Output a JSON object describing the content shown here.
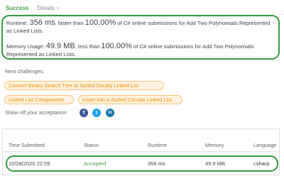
{
  "tabs": {
    "success": "Success",
    "details": "Details"
  },
  "result": {
    "runtime_label": "Runtime: ",
    "runtime_value": "356 ms",
    "runtime_mid": ", faster than ",
    "runtime_percent": "100.00%",
    "runtime_tail": " of C# online submissions for Add Two Polynomials Represented as Linked Lists.",
    "memory_label": "Memory Usage: ",
    "memory_value": "49.9 MB",
    "memory_mid": ", less than ",
    "memory_percent": "100.00%",
    "memory_tail": " of C# online submissions for Add Two Polynomials Represented as Linked Lists."
  },
  "next_challenges": {
    "label": "Next challenges:",
    "items": [
      "Convert Binary Search Tree to Sorted Doubly Linked List",
      "Linked List Components",
      "Insert into a Sorted Circular Linked List"
    ]
  },
  "share": {
    "label": "Show off your acceptance:",
    "facebook": "f",
    "twitter": "t",
    "linkedin": "in"
  },
  "table": {
    "headers": [
      "Time Submitted",
      "Status",
      "Runtime",
      "Memory",
      "Language"
    ],
    "rows": [
      [
        "10/28/2020 22:59",
        "Accepted",
        "356 ms",
        "49.9 MB",
        "csharp"
      ]
    ]
  },
  "colors": {
    "success_green": "#43a047",
    "highlight_border": "#2e9e3e",
    "chip_orange": "#ef8c00"
  }
}
